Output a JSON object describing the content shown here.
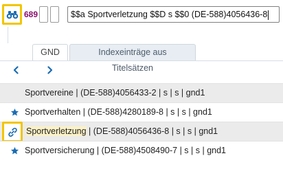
{
  "top_bar": {
    "tag": "689",
    "field_value": "$$a Sportverletzung $$D s $$0 (DE-588)4056436-8"
  },
  "icons": {
    "search": "binoculars-icon",
    "prev": "chevron-left-icon",
    "next": "chevron-right-icon",
    "star": "star-icon",
    "link": "link-icon"
  },
  "colors": {
    "accent": "#1b6db2",
    "highlight_border": "#f2c500",
    "tag": "#8a0a6c"
  },
  "tabs": [
    {
      "label": "GND",
      "active": true
    },
    {
      "label": "Indexeinträge aus Titelsätzen",
      "active": false
    }
  ],
  "results": [
    {
      "text": "Sportvereine | (DE-588)4056433-2 | s | s | gnd1",
      "marker": "none"
    },
    {
      "text": "Sportverhalten | (DE-588)4280189-8 | s | s | gnd1",
      "marker": "star"
    },
    {
      "term": "Sportverletzung",
      "rest": " | (DE-588)4056436-8 | s | s | gnd1",
      "marker": "link"
    },
    {
      "text": "Sportversicherung | (DE-588)4508490-7 | s | s | gnd1",
      "marker": "star"
    }
  ]
}
